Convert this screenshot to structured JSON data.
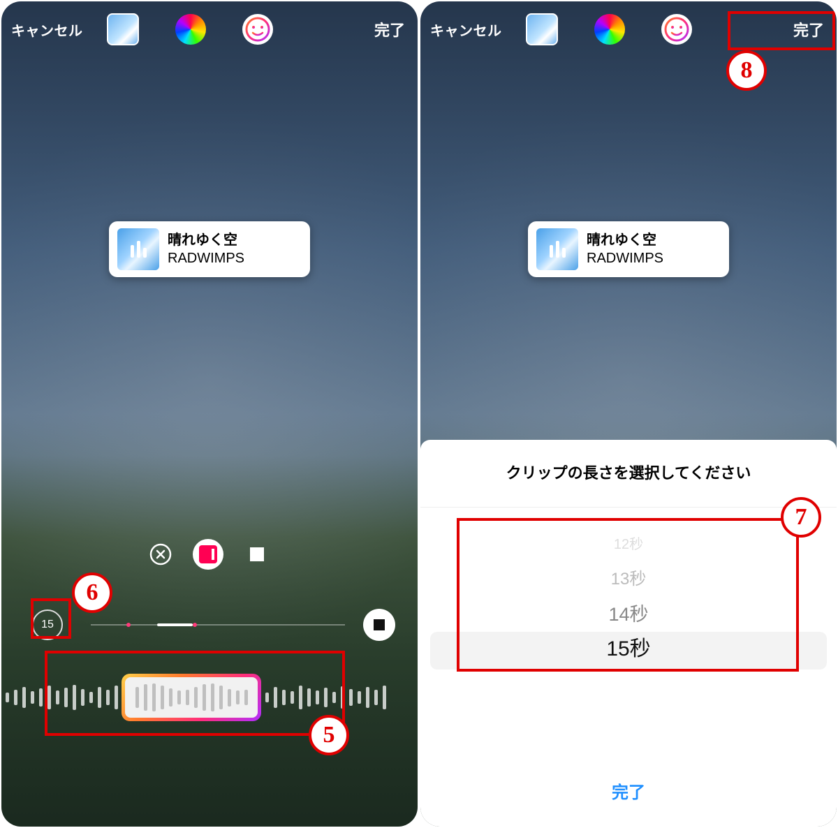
{
  "topbar": {
    "cancel": "キャンセル",
    "done": "完了",
    "icons": {
      "thumb": "sky-thumb-icon",
      "color": "color-wheel-icon",
      "face": "face-filter-icon"
    }
  },
  "music_sticker": {
    "title": "晴れゆく空",
    "artist": "RADWIMPS"
  },
  "left": {
    "duration_label": "15"
  },
  "right": {
    "panel_title": "クリップの長さを選択してください",
    "picker_options": [
      "12秒",
      "13秒",
      "14秒",
      "15秒"
    ],
    "selected_index": 3,
    "footer_done": "完了"
  },
  "annotations": {
    "five": "5",
    "six": "6",
    "seven": "7",
    "eight": "8"
  }
}
